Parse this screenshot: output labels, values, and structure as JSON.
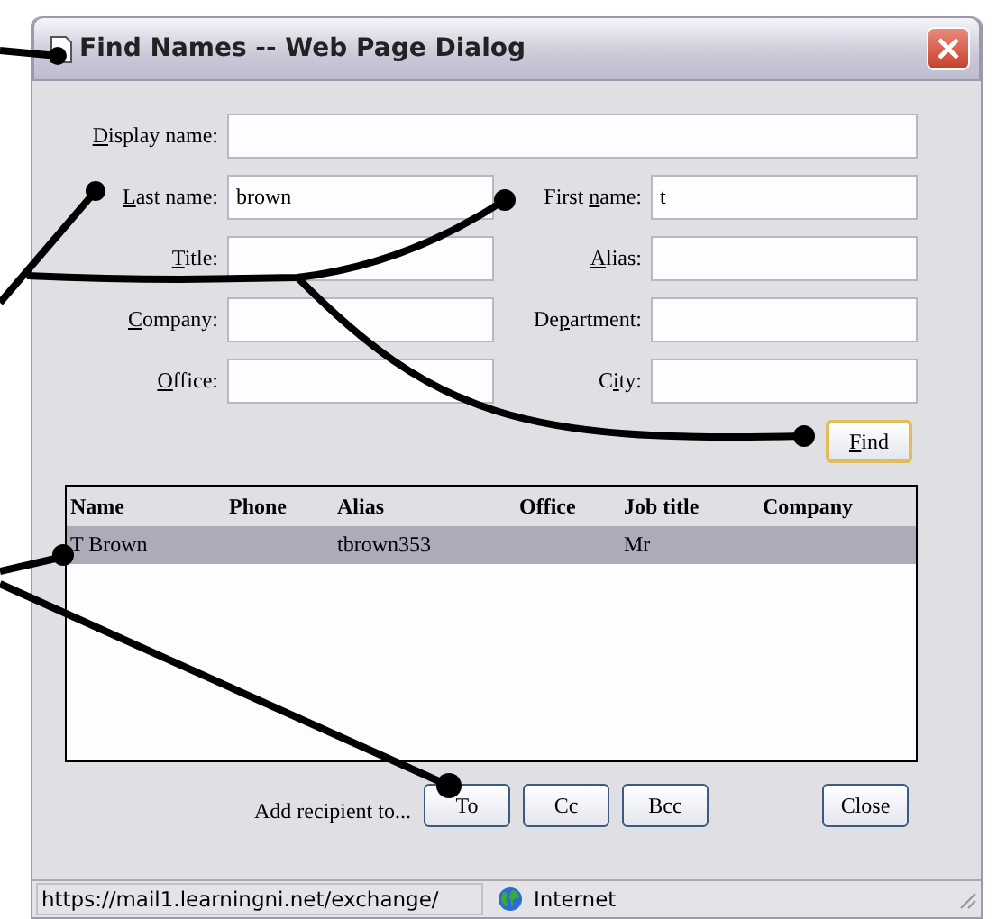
{
  "window": {
    "title": "Find Names -- Web Page Dialog"
  },
  "form": {
    "rows": [
      [
        {
          "access_key": "D",
          "label_end": "isplay name:",
          "kind": "wide"
        }
      ],
      [
        {
          "access_key": "L",
          "label_end": "ast name:",
          "value": "brown",
          "kind": "half"
        },
        {
          "label_start": "First ",
          "access_key": "n",
          "label_end": "ame:",
          "value": "t",
          "kind": "half"
        }
      ],
      [
        {
          "access_key": "T",
          "label_end": "itle:",
          "kind": "half"
        },
        {
          "access_key": "A",
          "label_end": "lias:",
          "kind": "half"
        }
      ],
      [
        {
          "access_key": "C",
          "label_end": "ompany:",
          "kind": "half"
        },
        {
          "label_start": "De",
          "access_key": "p",
          "label_end": "artment:",
          "kind": "half"
        }
      ],
      [
        {
          "access_key": "O",
          "label_end": "ffice:",
          "kind": "half"
        },
        {
          "label_start": "C",
          "access_key": "i",
          "label_end": "ty:",
          "kind": "half"
        }
      ]
    ],
    "find_button": {
      "access_key": "F",
      "label_end": "ind"
    }
  },
  "table": {
    "columns": [
      "Name",
      "Phone",
      "Alias",
      "Office",
      "Job title",
      "Company"
    ],
    "rows": [
      {
        "cells": [
          "T Brown",
          null,
          "tbrown353",
          null,
          "Mr",
          null
        ],
        "selected": true
      }
    ]
  },
  "recipient": {
    "label": "Add recipient to...",
    "buttons": [
      "To",
      "Cc",
      "Bcc"
    ]
  },
  "close_button": "Close",
  "status_bar": {
    "url": "https://mail1.learningni.net/exchange/",
    "zone": "Internet"
  }
}
